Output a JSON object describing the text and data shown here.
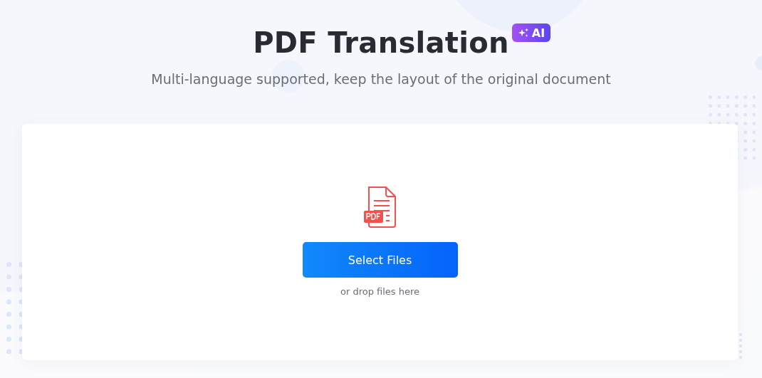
{
  "title": "PDF Translation",
  "badge": "AI",
  "subtitle": "Multi-language supported, keep the layout of the original document",
  "upload": {
    "button": "Select Files",
    "hint": "or drop files here"
  }
}
